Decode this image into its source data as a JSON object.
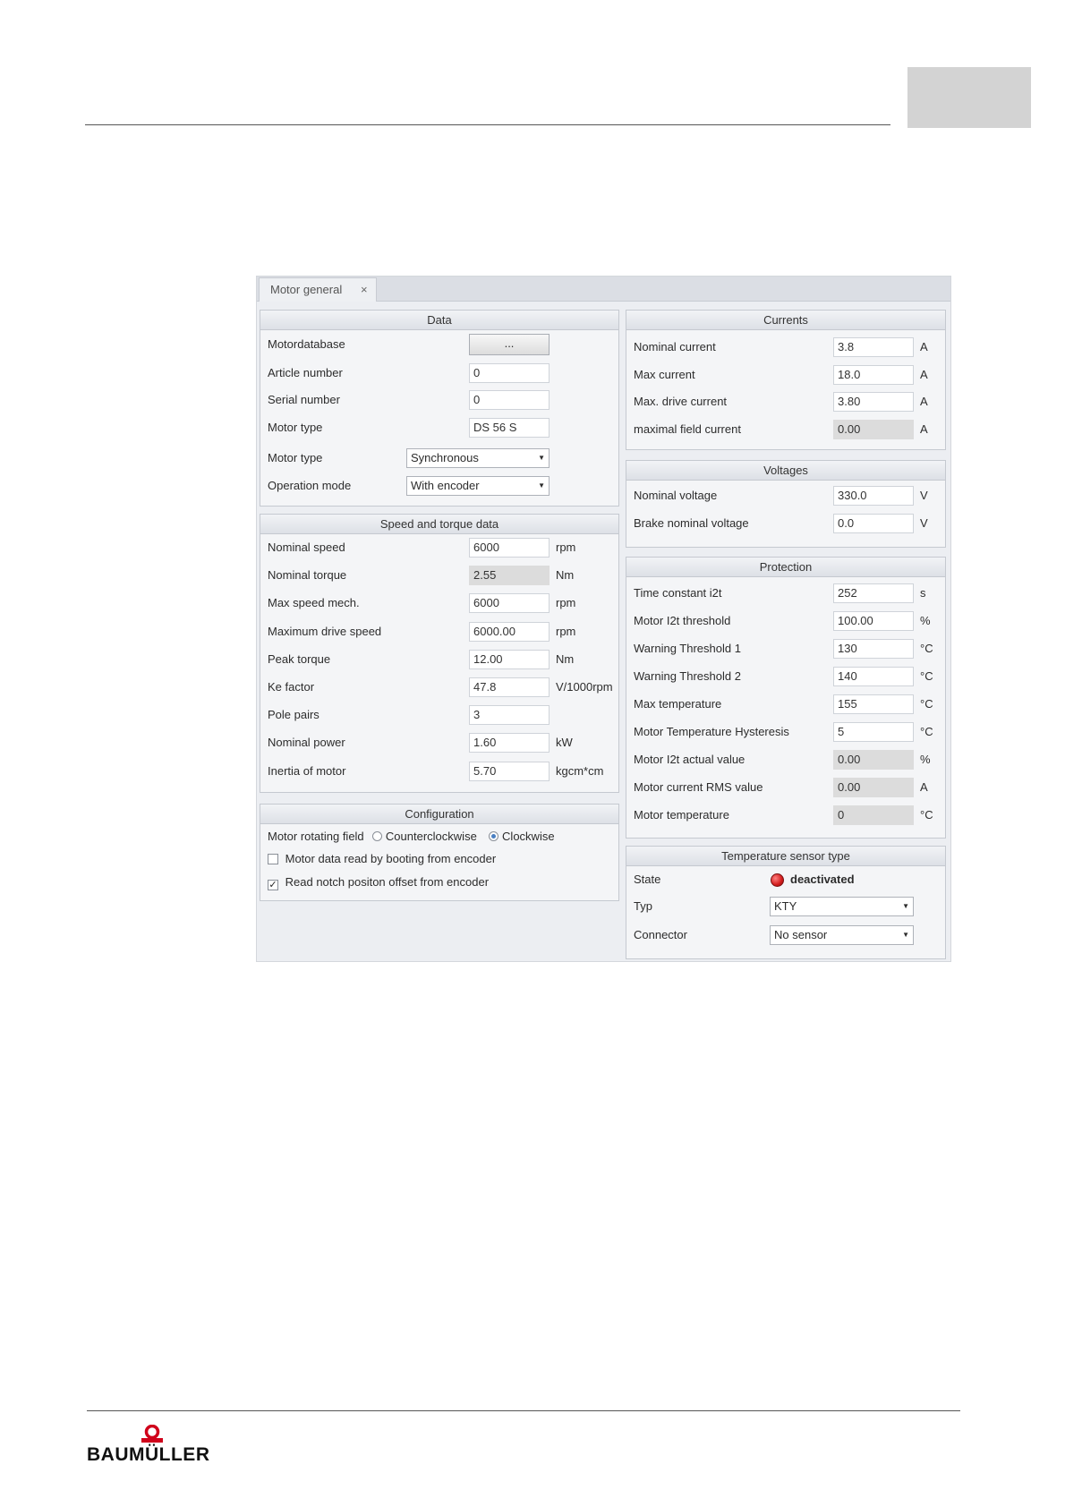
{
  "app": {
    "tab_label": "Motor general",
    "tab_close": "×"
  },
  "data_group": {
    "title": "Data",
    "motordatabase_label": "Motordatabase",
    "motordatabase_button": "...",
    "article_number_label": "Article number",
    "article_number": "0",
    "serial_number_label": "Serial number",
    "serial_number": "0",
    "motor_type_label": "Motor type",
    "motor_type_value": "DS 56 S",
    "motor_type2_label": "Motor type",
    "motor_type2_selected": "Synchronous",
    "operation_mode_label": "Operation mode",
    "operation_mode_selected": "With encoder"
  },
  "speed_torque": {
    "title": "Speed and torque data",
    "rows": [
      {
        "label": "Nominal speed",
        "value": "6000",
        "unit": "rpm",
        "readonly": false
      },
      {
        "label": "Nominal torque",
        "value": "2.55",
        "unit": "Nm",
        "readonly": true
      },
      {
        "label": "Max speed mech.",
        "value": "6000",
        "unit": "rpm",
        "readonly": false
      },
      {
        "label": "Maximum drive speed",
        "value": "6000.00",
        "unit": "rpm",
        "readonly": false
      },
      {
        "label": "Peak torque",
        "value": "12.00",
        "unit": "Nm",
        "readonly": false
      },
      {
        "label": "Ke factor",
        "value": "47.8",
        "unit": "V/1000rpm",
        "readonly": false
      },
      {
        "label": "Pole pairs",
        "value": "3",
        "unit": "",
        "readonly": false
      },
      {
        "label": "Nominal power",
        "value": "1.60",
        "unit": "kW",
        "readonly": false
      },
      {
        "label": "Inertia of motor",
        "value": "5.70",
        "unit": "kgcm*cm",
        "readonly": false
      }
    ]
  },
  "configuration": {
    "title": "Configuration",
    "rotating_field_label": "Motor rotating field",
    "option_ccw": "Counterclockwise",
    "option_cw": "Clockwise",
    "selected": "Clockwise",
    "check_booting": "Motor data read by booting from encoder",
    "check_booting_checked": false,
    "check_notch": "Read notch positon offset from encoder",
    "check_notch_checked": true
  },
  "currents": {
    "title": "Currents",
    "rows": [
      {
        "label": "Nominal current",
        "value": "3.8",
        "unit": "A",
        "readonly": false
      },
      {
        "label": "Max current",
        "value": "18.0",
        "unit": "A",
        "readonly": false
      },
      {
        "label": "Max. drive current",
        "value": "3.80",
        "unit": "A",
        "readonly": false
      },
      {
        "label": "maximal field current",
        "value": "0.00",
        "unit": "A",
        "readonly": true
      }
    ]
  },
  "voltages": {
    "title": "Voltages",
    "rows": [
      {
        "label": "Nominal voltage",
        "value": "330.0",
        "unit": "V",
        "readonly": false
      },
      {
        "label": "Brake nominal voltage",
        "value": "0.0",
        "unit": "V",
        "readonly": false
      }
    ]
  },
  "protection": {
    "title": "Protection",
    "rows": [
      {
        "label": "Time constant i2t",
        "value": "252",
        "unit": "s",
        "readonly": false
      },
      {
        "label": "Motor I2t threshold",
        "value": "100.00",
        "unit": "%",
        "readonly": false
      },
      {
        "label": "Warning Threshold 1",
        "value": "130",
        "unit": "°C",
        "readonly": false
      },
      {
        "label": "Warning Threshold 2",
        "value": "140",
        "unit": "°C",
        "readonly": false
      },
      {
        "label": "Max temperature",
        "value": "155",
        "unit": "°C",
        "readonly": false
      },
      {
        "label": "Motor Temperature Hysteresis",
        "value": "5",
        "unit": "°C",
        "readonly": false
      },
      {
        "label": "Motor I2t actual value",
        "value": "0.00",
        "unit": "%",
        "readonly": true
      },
      {
        "label": "Motor current RMS value",
        "value": "0.00",
        "unit": "A",
        "readonly": true
      },
      {
        "label": "Motor temperature",
        "value": "0",
        "unit": "°C",
        "readonly": true
      }
    ]
  },
  "temp_sensor": {
    "title": "Temperature sensor type",
    "state_label": "State",
    "state_value": "deactivated",
    "state_color": "#d21c1c",
    "typ_label": "Typ",
    "typ_selected": "KTY",
    "connector_label": "Connector",
    "connector_selected": "No sensor"
  },
  "footer": {
    "logo_text": "BAUMÜLLER"
  }
}
